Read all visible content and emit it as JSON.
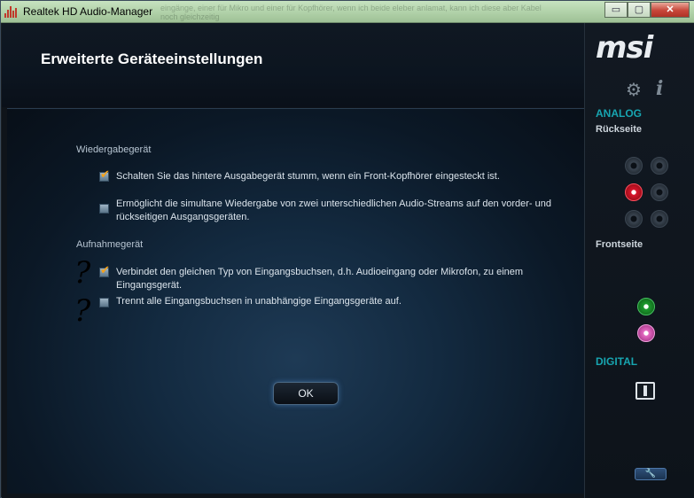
{
  "window": {
    "title": "Realtek HD Audio-Manager",
    "background_ghost_text": "eingänge, einer für Mikro und einer für Kopfhörer, wenn ich beide eleber anlamat, kann ich diese aber Kabel noch gleichzeitig",
    "buttons": {
      "minimize": "▭",
      "maximize": "▢",
      "close": "✕"
    }
  },
  "header": {
    "title": "Erweiterte Geräteeinstellungen"
  },
  "playback": {
    "label": "Wiedergabegerät",
    "options": [
      {
        "text": "Schalten Sie das hintere Ausgabegerät stumm, wenn ein Front-Kopfhörer eingesteckt ist.",
        "checked": true
      },
      {
        "text": "Ermöglicht die simultane Wiedergabe von zwei unterschiedlichen Audio-Streams auf den vorder- und rückseitigen Ausgangsgeräten.",
        "checked": false
      }
    ]
  },
  "recording": {
    "label": "Aufnahmegerät",
    "options": [
      {
        "text": "Verbindet den gleichen Typ von Eingangsbuchsen, d.h. Audioeingang oder Mikrofon, zu einem Eingangsgerät.",
        "checked": true
      },
      {
        "text": "Trennt alle Eingangsbuchsen in unabhängige Eingangsgeräte auf.",
        "checked": false
      }
    ],
    "annotations": [
      "?",
      "?"
    ]
  },
  "ok_label": "OK",
  "sidebar": {
    "brand": "msi",
    "icons": {
      "settings": "gear-icon",
      "info": "info-icon"
    },
    "analog_label": "ANALOG",
    "back_label": "Rückseite",
    "front_label": "Frontseite",
    "digital_label": "DIGITAL",
    "wrench": "🔧",
    "jack_colors": {
      "red": "#d8142b",
      "green": "#1c9a2e",
      "pink": "#e46ac2",
      "teal_text": "#17a5b0"
    }
  }
}
